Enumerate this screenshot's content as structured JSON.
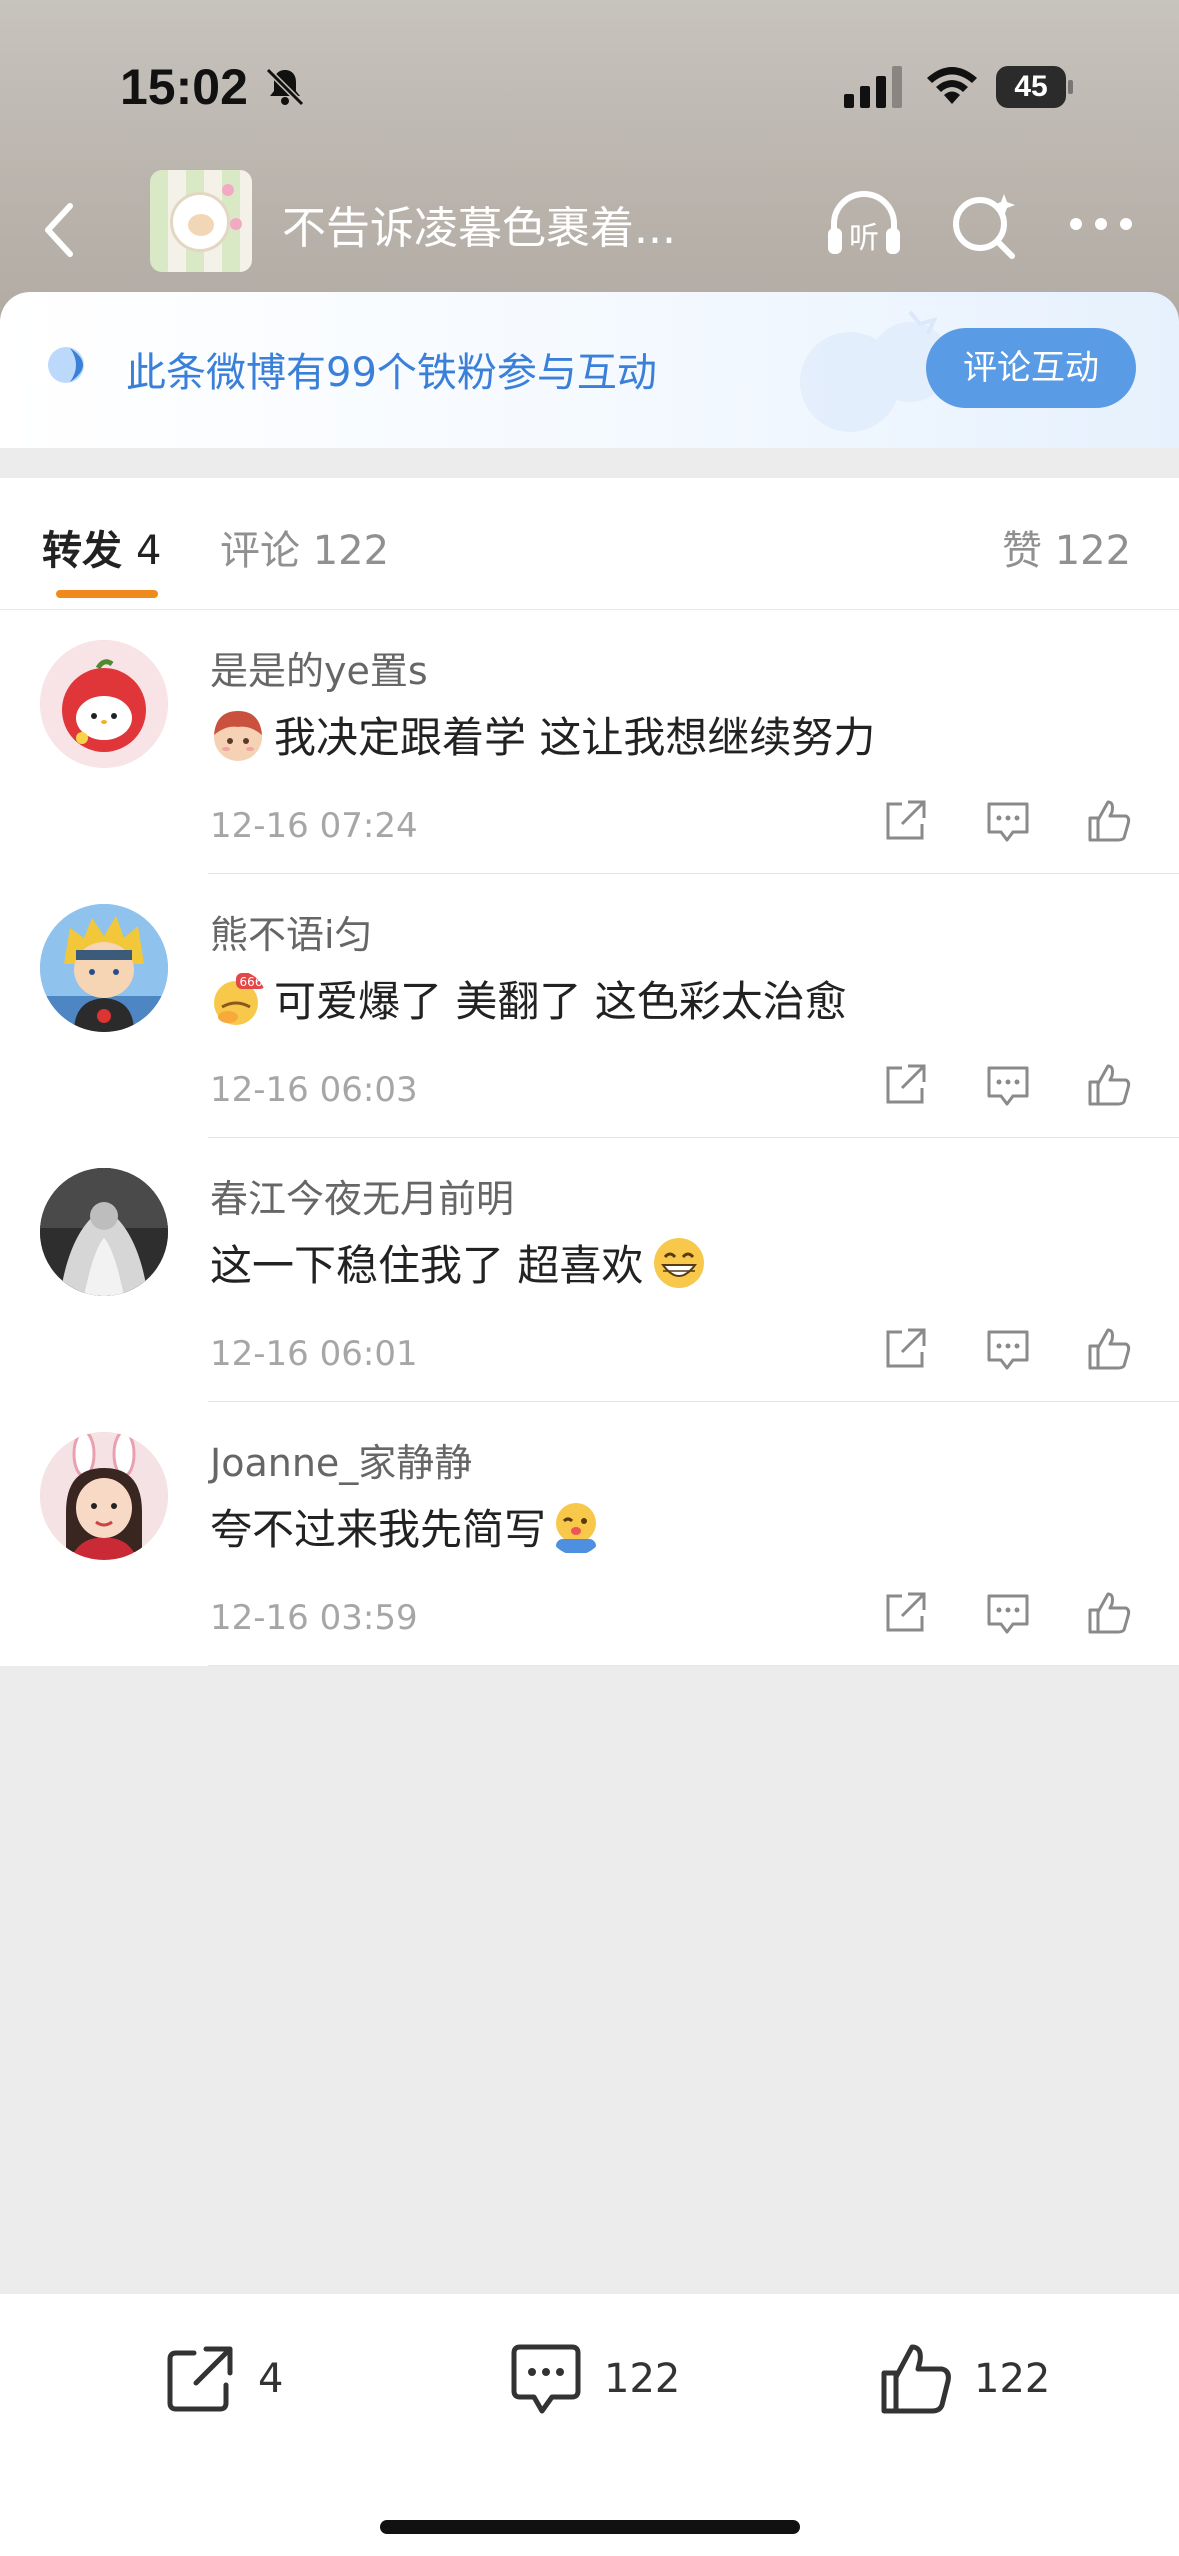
{
  "status_bar": {
    "time": "15:02",
    "battery": "45",
    "icons": [
      "bell-off-icon",
      "signal-icon",
      "wifi-icon",
      "battery-icon"
    ]
  },
  "nav": {
    "title": "不告诉凌暮色裹着...",
    "listen_label": "听",
    "icons": [
      "back-icon",
      "listen-icon",
      "search-icon",
      "more-icon"
    ]
  },
  "fans_banner": {
    "text": "此条微博有99个铁粉参与互动",
    "button": "评论互动",
    "accent": "#3a80d9"
  },
  "tabs": {
    "repost": {
      "label": "转发",
      "count": "4"
    },
    "comment": {
      "label": "评论",
      "count": "122"
    },
    "like": {
      "label": "赞",
      "count": "122"
    },
    "active_color": "#f08a1c"
  },
  "comments": [
    {
      "name": "是是的ye置s",
      "text": "我决定跟着学 这让我想继续努力",
      "time": "12-16 07:24",
      "emoji": "boy-face-emoji"
    },
    {
      "name": "熊不语i匀",
      "text": "可爱爆了 美翻了 这色彩太治愈",
      "time": "12-16 06:03",
      "emoji": "666-emoji"
    },
    {
      "name": "春江今夜无月前明",
      "text": "这一下稳住我了 超喜欢",
      "time": "12-16 06:01",
      "emoji": "grin-emoji"
    },
    {
      "name": "Joanne_家静静",
      "text": "夸不过来我先简写",
      "time": "12-16 03:59",
      "emoji": "wink-emoji"
    }
  ],
  "bottom_bar": {
    "repost_count": "4",
    "comment_count": "122",
    "like_count": "122"
  }
}
